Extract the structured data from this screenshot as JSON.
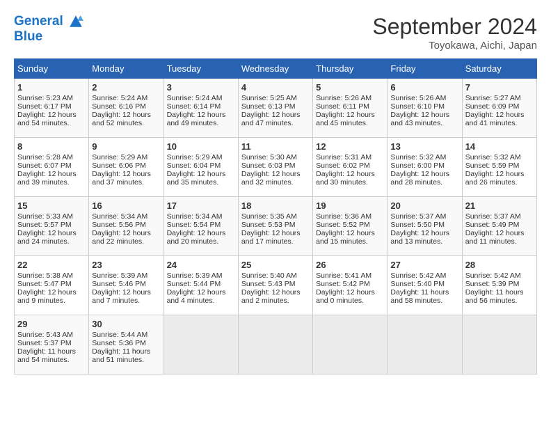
{
  "header": {
    "logo_line1": "General",
    "logo_line2": "Blue",
    "title": "September 2024",
    "location": "Toyokawa, Aichi, Japan"
  },
  "days_of_week": [
    "Sunday",
    "Monday",
    "Tuesday",
    "Wednesday",
    "Thursday",
    "Friday",
    "Saturday"
  ],
  "weeks": [
    [
      {
        "day": 1,
        "lines": [
          "Sunrise: 5:23 AM",
          "Sunset: 6:17 PM",
          "Daylight: 12 hours",
          "and 54 minutes."
        ]
      },
      {
        "day": 2,
        "lines": [
          "Sunrise: 5:24 AM",
          "Sunset: 6:16 PM",
          "Daylight: 12 hours",
          "and 52 minutes."
        ]
      },
      {
        "day": 3,
        "lines": [
          "Sunrise: 5:24 AM",
          "Sunset: 6:14 PM",
          "Daylight: 12 hours",
          "and 49 minutes."
        ]
      },
      {
        "day": 4,
        "lines": [
          "Sunrise: 5:25 AM",
          "Sunset: 6:13 PM",
          "Daylight: 12 hours",
          "and 47 minutes."
        ]
      },
      {
        "day": 5,
        "lines": [
          "Sunrise: 5:26 AM",
          "Sunset: 6:11 PM",
          "Daylight: 12 hours",
          "and 45 minutes."
        ]
      },
      {
        "day": 6,
        "lines": [
          "Sunrise: 5:26 AM",
          "Sunset: 6:10 PM",
          "Daylight: 12 hours",
          "and 43 minutes."
        ]
      },
      {
        "day": 7,
        "lines": [
          "Sunrise: 5:27 AM",
          "Sunset: 6:09 PM",
          "Daylight: 12 hours",
          "and 41 minutes."
        ]
      }
    ],
    [
      {
        "day": 8,
        "lines": [
          "Sunrise: 5:28 AM",
          "Sunset: 6:07 PM",
          "Daylight: 12 hours",
          "and 39 minutes."
        ]
      },
      {
        "day": 9,
        "lines": [
          "Sunrise: 5:29 AM",
          "Sunset: 6:06 PM",
          "Daylight: 12 hours",
          "and 37 minutes."
        ]
      },
      {
        "day": 10,
        "lines": [
          "Sunrise: 5:29 AM",
          "Sunset: 6:04 PM",
          "Daylight: 12 hours",
          "and 35 minutes."
        ]
      },
      {
        "day": 11,
        "lines": [
          "Sunrise: 5:30 AM",
          "Sunset: 6:03 PM",
          "Daylight: 12 hours",
          "and 32 minutes."
        ]
      },
      {
        "day": 12,
        "lines": [
          "Sunrise: 5:31 AM",
          "Sunset: 6:02 PM",
          "Daylight: 12 hours",
          "and 30 minutes."
        ]
      },
      {
        "day": 13,
        "lines": [
          "Sunrise: 5:32 AM",
          "Sunset: 6:00 PM",
          "Daylight: 12 hours",
          "and 28 minutes."
        ]
      },
      {
        "day": 14,
        "lines": [
          "Sunrise: 5:32 AM",
          "Sunset: 5:59 PM",
          "Daylight: 12 hours",
          "and 26 minutes."
        ]
      }
    ],
    [
      {
        "day": 15,
        "lines": [
          "Sunrise: 5:33 AM",
          "Sunset: 5:57 PM",
          "Daylight: 12 hours",
          "and 24 minutes."
        ]
      },
      {
        "day": 16,
        "lines": [
          "Sunrise: 5:34 AM",
          "Sunset: 5:56 PM",
          "Daylight: 12 hours",
          "and 22 minutes."
        ]
      },
      {
        "day": 17,
        "lines": [
          "Sunrise: 5:34 AM",
          "Sunset: 5:54 PM",
          "Daylight: 12 hours",
          "and 20 minutes."
        ]
      },
      {
        "day": 18,
        "lines": [
          "Sunrise: 5:35 AM",
          "Sunset: 5:53 PM",
          "Daylight: 12 hours",
          "and 17 minutes."
        ]
      },
      {
        "day": 19,
        "lines": [
          "Sunrise: 5:36 AM",
          "Sunset: 5:52 PM",
          "Daylight: 12 hours",
          "and 15 minutes."
        ]
      },
      {
        "day": 20,
        "lines": [
          "Sunrise: 5:37 AM",
          "Sunset: 5:50 PM",
          "Daylight: 12 hours",
          "and 13 minutes."
        ]
      },
      {
        "day": 21,
        "lines": [
          "Sunrise: 5:37 AM",
          "Sunset: 5:49 PM",
          "Daylight: 12 hours",
          "and 11 minutes."
        ]
      }
    ],
    [
      {
        "day": 22,
        "lines": [
          "Sunrise: 5:38 AM",
          "Sunset: 5:47 PM",
          "Daylight: 12 hours",
          "and 9 minutes."
        ]
      },
      {
        "day": 23,
        "lines": [
          "Sunrise: 5:39 AM",
          "Sunset: 5:46 PM",
          "Daylight: 12 hours",
          "and 7 minutes."
        ]
      },
      {
        "day": 24,
        "lines": [
          "Sunrise: 5:39 AM",
          "Sunset: 5:44 PM",
          "Daylight: 12 hours",
          "and 4 minutes."
        ]
      },
      {
        "day": 25,
        "lines": [
          "Sunrise: 5:40 AM",
          "Sunset: 5:43 PM",
          "Daylight: 12 hours",
          "and 2 minutes."
        ]
      },
      {
        "day": 26,
        "lines": [
          "Sunrise: 5:41 AM",
          "Sunset: 5:42 PM",
          "Daylight: 12 hours",
          "and 0 minutes."
        ]
      },
      {
        "day": 27,
        "lines": [
          "Sunrise: 5:42 AM",
          "Sunset: 5:40 PM",
          "Daylight: 11 hours",
          "and 58 minutes."
        ]
      },
      {
        "day": 28,
        "lines": [
          "Sunrise: 5:42 AM",
          "Sunset: 5:39 PM",
          "Daylight: 11 hours",
          "and 56 minutes."
        ]
      }
    ],
    [
      {
        "day": 29,
        "lines": [
          "Sunrise: 5:43 AM",
          "Sunset: 5:37 PM",
          "Daylight: 11 hours",
          "and 54 minutes."
        ]
      },
      {
        "day": 30,
        "lines": [
          "Sunrise: 5:44 AM",
          "Sunset: 5:36 PM",
          "Daylight: 11 hours",
          "and 51 minutes."
        ]
      },
      null,
      null,
      null,
      null,
      null
    ]
  ]
}
